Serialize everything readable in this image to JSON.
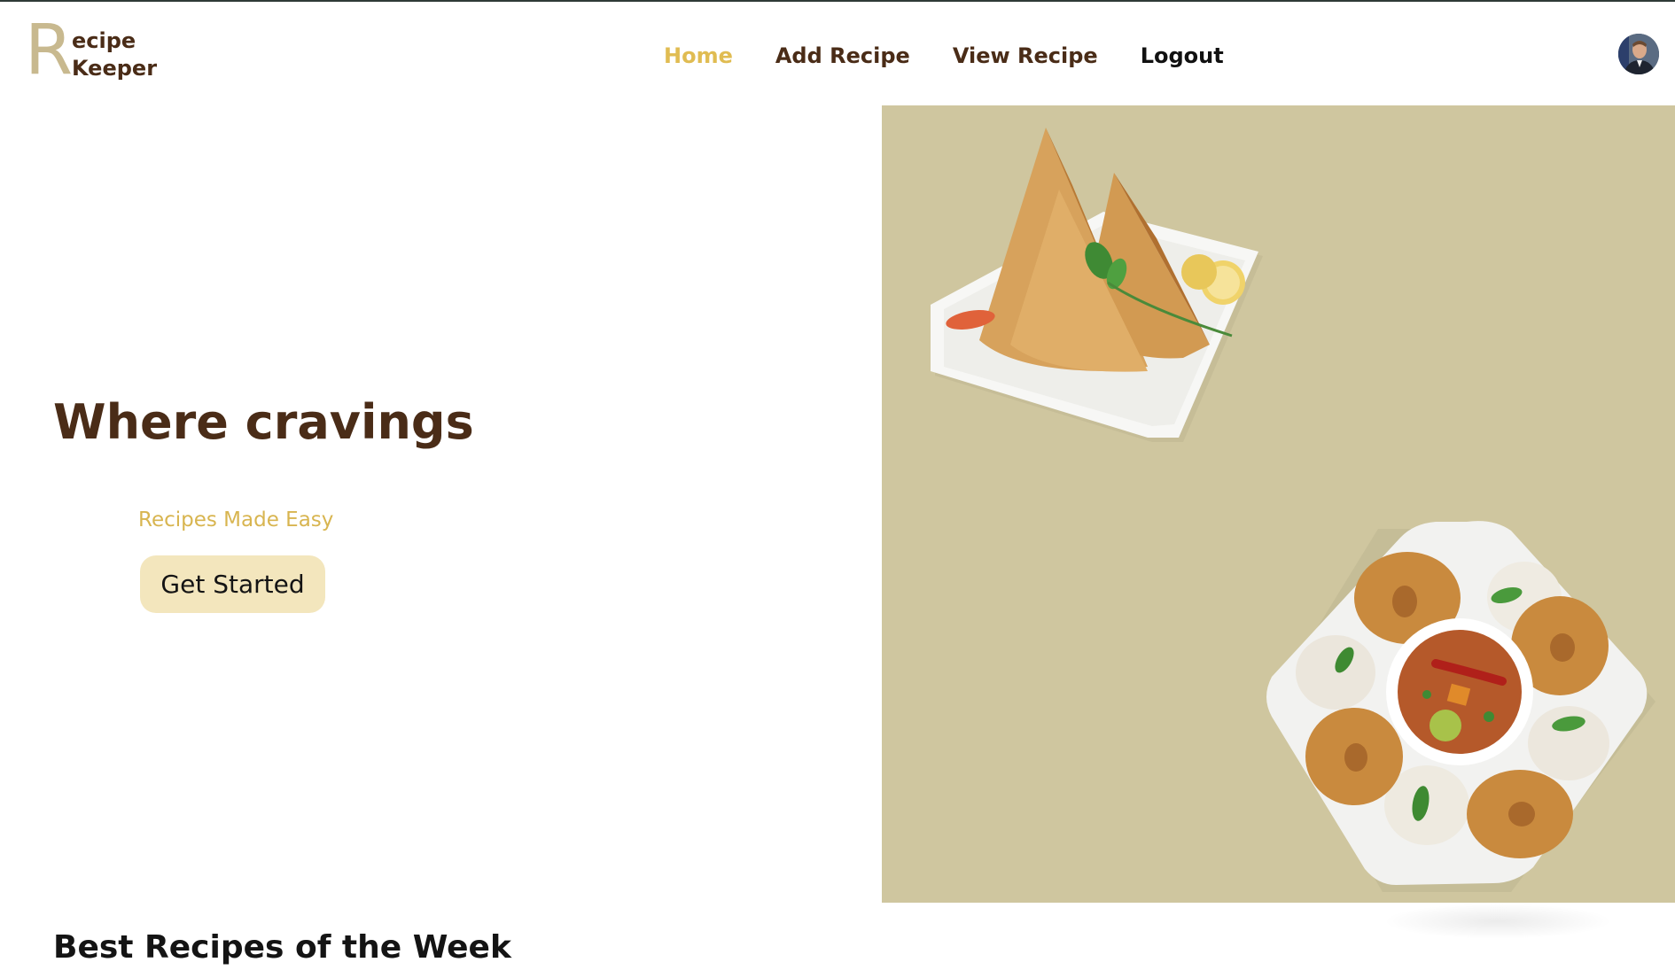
{
  "header": {
    "logo": {
      "initial": "R",
      "line1": "ecipe",
      "line2": "Keeper"
    },
    "nav": [
      {
        "label": "Home",
        "active": true
      },
      {
        "label": "Add Recipe",
        "active": false
      },
      {
        "label": "View Recipe",
        "active": false
      },
      {
        "label": "Logout",
        "active": false
      }
    ],
    "avatar_icon": "user-avatar"
  },
  "hero": {
    "title": "Where cravings",
    "subtitle": "Recipes Made Easy",
    "cta_label": "Get Started"
  },
  "sections": {
    "best_title": "Best Recipes of the Week"
  },
  "colors": {
    "brand_brown": "#4a2c17",
    "accent_gold": "#e0bc52",
    "panel_beige": "#cfc69f",
    "button_cream": "#f3e6bd"
  }
}
